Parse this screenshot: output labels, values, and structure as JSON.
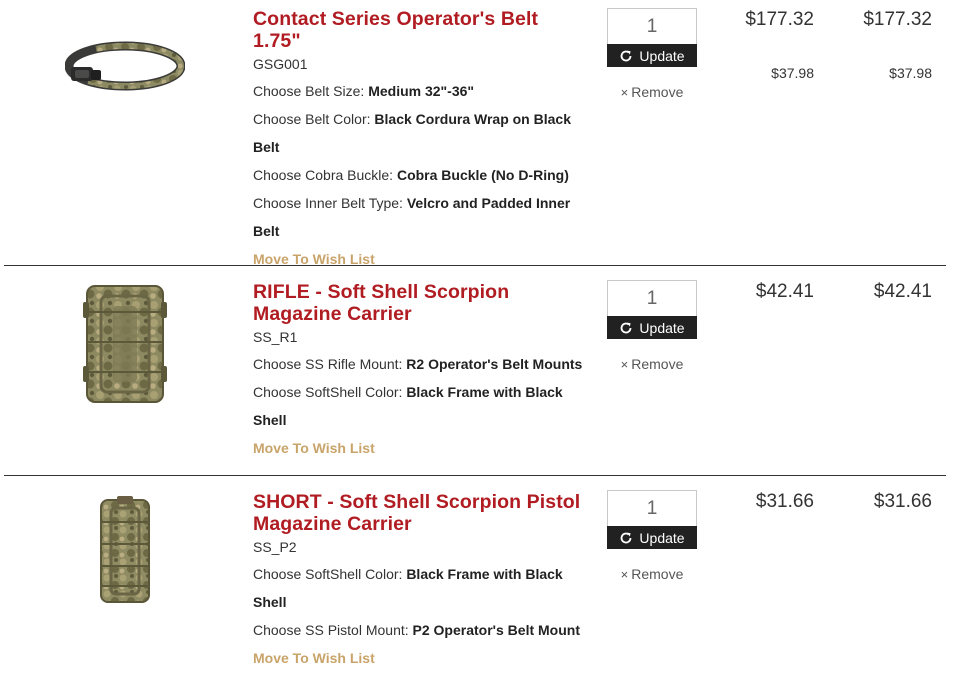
{
  "items": [
    {
      "name": "Contact Series Operator's Belt 1.75\"",
      "sku": "GSG001",
      "options": [
        {
          "label": "Choose Belt Size:",
          "value": "Medium 32\"-36\""
        },
        {
          "label": "Choose Belt Color:",
          "value": "Black Cordura Wrap on Black Belt"
        },
        {
          "label": "Choose Cobra Buckle:",
          "value": "Cobra Buckle (No D-Ring)"
        },
        {
          "label": "Choose Inner Belt Type:",
          "value": "Velcro and Padded Inner Belt"
        }
      ],
      "wishlist_label": "Move To Wish List",
      "quantity": "1",
      "update_label": "Update",
      "remove_label": "Remove",
      "unit_price": "$177.32",
      "total_price": "$177.32",
      "unit_sub_price": "$37.98",
      "total_sub_price": "$37.98"
    },
    {
      "name": "RIFLE - Soft Shell Scorpion Magazine Carrier",
      "sku": "SS_R1",
      "options": [
        {
          "label": "Choose SS Rifle Mount:",
          "value": "R2 Operator's Belt Mounts"
        },
        {
          "label": "Choose SoftShell Color:",
          "value": "Black Frame with Black Shell"
        }
      ],
      "wishlist_label": "Move To Wish List",
      "quantity": "1",
      "update_label": "Update",
      "remove_label": "Remove",
      "unit_price": "$42.41",
      "total_price": "$42.41"
    },
    {
      "name": "SHORT - Soft Shell Scorpion Pistol Magazine Carrier",
      "sku": "SS_P2",
      "options": [
        {
          "label": "Choose SoftShell Color:",
          "value": "Black Frame with Black Shell"
        },
        {
          "label": "Choose SS Pistol Mount:",
          "value": "P2 Operator's Belt Mount"
        }
      ],
      "wishlist_label": "Move To Wish List",
      "quantity": "1",
      "update_label": "Update",
      "remove_label": "Remove",
      "unit_price": "$31.66",
      "total_price": "$31.66"
    }
  ],
  "icons": {
    "update": "refresh-icon",
    "remove": "close-icon"
  },
  "colors": {
    "product_name": "#b01c22",
    "wishlist_link": "#c9a46a",
    "update_button": "#212121"
  }
}
